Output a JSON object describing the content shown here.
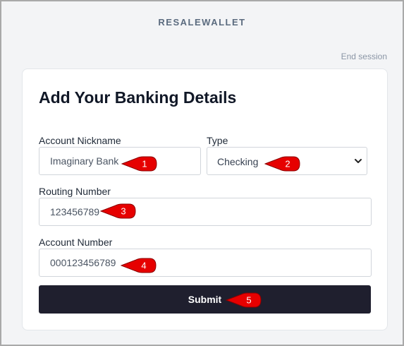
{
  "header": {
    "brand": "RESALEWALLET",
    "end_session_label": "End session"
  },
  "form": {
    "title": "Add Your Banking Details",
    "nickname": {
      "label": "Account Nickname",
      "value": "Imaginary Bank"
    },
    "type": {
      "label": "Type",
      "selected": "Checking"
    },
    "routing": {
      "label": "Routing Number",
      "value": "123456789"
    },
    "account": {
      "label": "Account Number",
      "value": "000123456789"
    },
    "submit_label": "Submit"
  },
  "annotations": [
    "1",
    "2",
    "3",
    "4",
    "5"
  ],
  "colors": {
    "marker": "#e60000",
    "submit_bg": "#1f1f2e",
    "brand_text": "#5b6b7f"
  }
}
